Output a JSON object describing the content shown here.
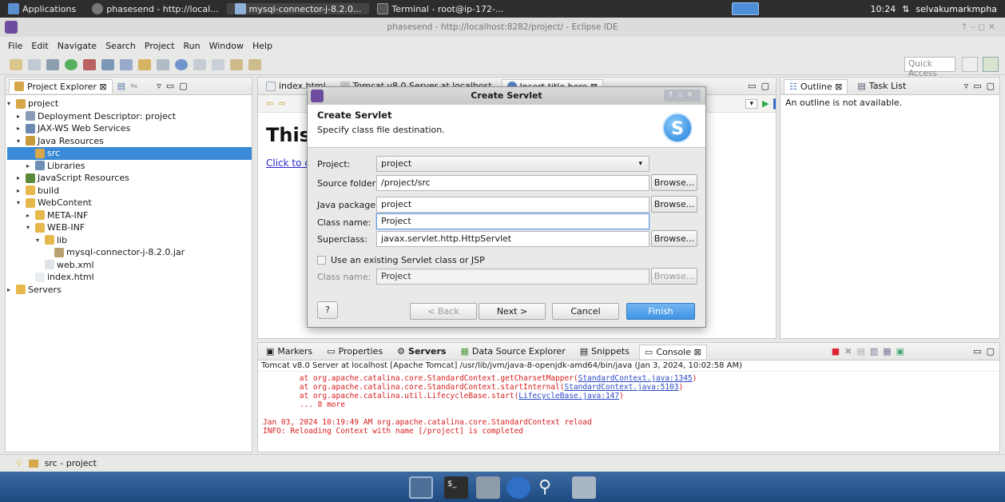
{
  "taskbar": {
    "items": [
      "Applications",
      "phasesend - http://local...",
      "mysql-connector-j-8.2.0...",
      "Terminal - root@ip-172-..."
    ],
    "time": "10:24",
    "user": "selvakumarkmpha"
  },
  "window": {
    "title": "phasesend - http://localhost:8282/project/ - Eclipse IDE"
  },
  "menu": [
    "File",
    "Edit",
    "Navigate",
    "Search",
    "Project",
    "Run",
    "Window",
    "Help"
  ],
  "quick_access": "Quick Access",
  "explorer": {
    "tab": "Project Explorer ⊠",
    "tree": [
      {
        "label": "project",
        "depth": 0,
        "tw": "▾",
        "icon": "project-icon"
      },
      {
        "label": "Deployment Descriptor: project",
        "depth": 1,
        "tw": "▸",
        "icon": "descriptor-icon"
      },
      {
        "label": "JAX-WS Web Services",
        "depth": 1,
        "tw": "▸",
        "icon": "webservice-icon"
      },
      {
        "label": "Java Resources",
        "depth": 1,
        "tw": "▾",
        "icon": "java-resources-icon"
      },
      {
        "label": "src",
        "depth": 2,
        "tw": "",
        "icon": "package-folder-icon",
        "selected": true
      },
      {
        "label": "Libraries",
        "depth": 2,
        "tw": "▸",
        "icon": "library-icon"
      },
      {
        "label": "JavaScript Resources",
        "depth": 1,
        "tw": "▸",
        "icon": "js-resources-icon"
      },
      {
        "label": "build",
        "depth": 1,
        "tw": "▸",
        "icon": "folder-icon"
      },
      {
        "label": "WebContent",
        "depth": 1,
        "tw": "▾",
        "icon": "folder-icon"
      },
      {
        "label": "META-INF",
        "depth": 2,
        "tw": "▸",
        "icon": "folder-icon"
      },
      {
        "label": "WEB-INF",
        "depth": 2,
        "tw": "▾",
        "icon": "folder-icon"
      },
      {
        "label": "lib",
        "depth": 3,
        "tw": "▾",
        "icon": "folder-icon"
      },
      {
        "label": "mysql-connector-j-8.2.0.jar",
        "depth": 4,
        "tw": "",
        "icon": "jar-icon"
      },
      {
        "label": "web.xml",
        "depth": 3,
        "tw": "",
        "icon": "xml-file-icon"
      },
      {
        "label": "index.html",
        "depth": 2,
        "tw": "",
        "icon": "html-file-icon"
      },
      {
        "label": "Servers",
        "depth": 0,
        "tw": "▸",
        "icon": "folder-icon"
      }
    ]
  },
  "editor": {
    "tabs": [
      "index.html",
      "Tomcat v8.0 Server at localhost",
      "Insert title here ⊠"
    ],
    "heading": "This",
    "link": "Click to c"
  },
  "outline": {
    "tabs": [
      "Outline ⊠",
      "Task List"
    ],
    "message": "An outline is not available."
  },
  "console": {
    "tabs": [
      "Markers",
      "Properties",
      "Servers",
      "Data Source Explorer",
      "Snippets",
      "Console ⊠"
    ],
    "header": "Tomcat v8.0 Server at localhost [Apache Tomcat] /usr/lib/jvm/java-8-openjdk-amd64/bin/java (Jan 3, 2024, 10:02:58 AM)",
    "lines": [
      {
        "pre": "        at org.apache.catalina.core.StandardContext.getCharsetMapper(",
        "link": "StandardContext.java:1345",
        "post": ")"
      },
      {
        "pre": "        at org.apache.catalina.core.StandardContext.startInternal(",
        "link": "StandardContext.java:5103",
        "post": ")"
      },
      {
        "pre": "        at org.apache.catalina.util.LifecycleBase.start(",
        "link": "LifecycleBase.java:147",
        "post": ")"
      },
      {
        "pre": "        ... 8 more",
        "link": "",
        "post": ""
      },
      {
        "pre": "",
        "link": "",
        "post": ""
      },
      {
        "pre": "Jan 03, 2024 10:19:49 AM org.apache.catalina.core.StandardContext reload",
        "link": "",
        "post": ""
      },
      {
        "pre": "INFO: Reloading Context with name [/project] is completed",
        "link": "",
        "post": ""
      }
    ]
  },
  "dialog": {
    "title": "Create Servlet",
    "heading": "Create Servlet",
    "subheading": "Specify class file destination.",
    "project_label": "Project:",
    "project_value": "project",
    "source_label": "Source folder:",
    "source_value": "/project/src",
    "package_label": "Java package:",
    "package_value": "project",
    "class_label": "Class name:",
    "class_value": "Project",
    "super_label": "Superclass:",
    "super_value": "javax.servlet.http.HttpServlet",
    "existing_label": "Use an existing Servlet class or JSP",
    "existing_class_label": "Class name:",
    "existing_class_value": "Project",
    "browse": "Browse...",
    "back": "< Back",
    "next": "Next >",
    "cancel": "Cancel",
    "finish": "Finish",
    "help": "?"
  },
  "status": {
    "text": "src - project"
  }
}
